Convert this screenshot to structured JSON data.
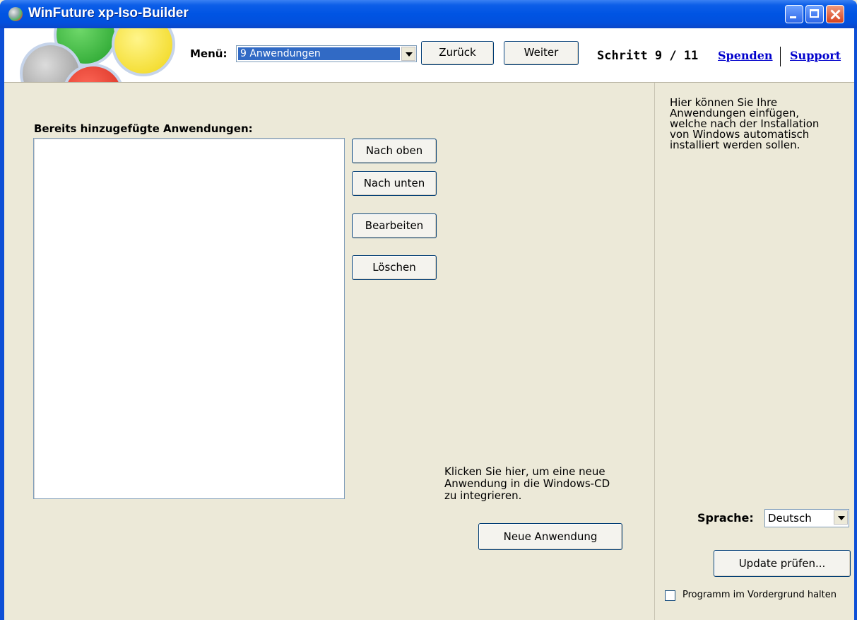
{
  "window": {
    "title": "WinFuture xp-Iso-Builder",
    "app_icon": "cd-icon"
  },
  "toolbar": {
    "menu_label": "Menü:",
    "menu_selected": "9 Anwendungen",
    "back_label": "Zurück",
    "next_label": "Weiter",
    "step_text": "Schritt 9 / 11",
    "spenden_link": "Spenden",
    "support_link": "Support"
  },
  "main": {
    "list_label": "Bereits hinzugefügte Anwendungen:",
    "list_items": [],
    "buttons": {
      "up": "Nach oben",
      "down": "Nach unten",
      "edit": "Bearbeiten",
      "delete": "Löschen"
    },
    "info_text": "Klicken Sie hier, um eine neue\nAnwendung in die Windows-CD\nzu integrieren.",
    "new_app_button": "Neue Anwendung"
  },
  "sidebar": {
    "help_text": "Hier können Sie Ihre\nAnwendungen einfügen,\nwelche nach der Installation\nvon Windows automatisch\ninstalliert werden sollen.",
    "language_label": "Sprache:",
    "language_value": "Deutsch",
    "update_button": "Update prüfen...",
    "foreground_checkbox_label": "Programm im Vordergrund halten",
    "foreground_checked": false
  },
  "colors": {
    "titlebar": "#0054e3",
    "background": "#ece9d8",
    "selection": "#316ac5",
    "link": "#0000cc"
  }
}
